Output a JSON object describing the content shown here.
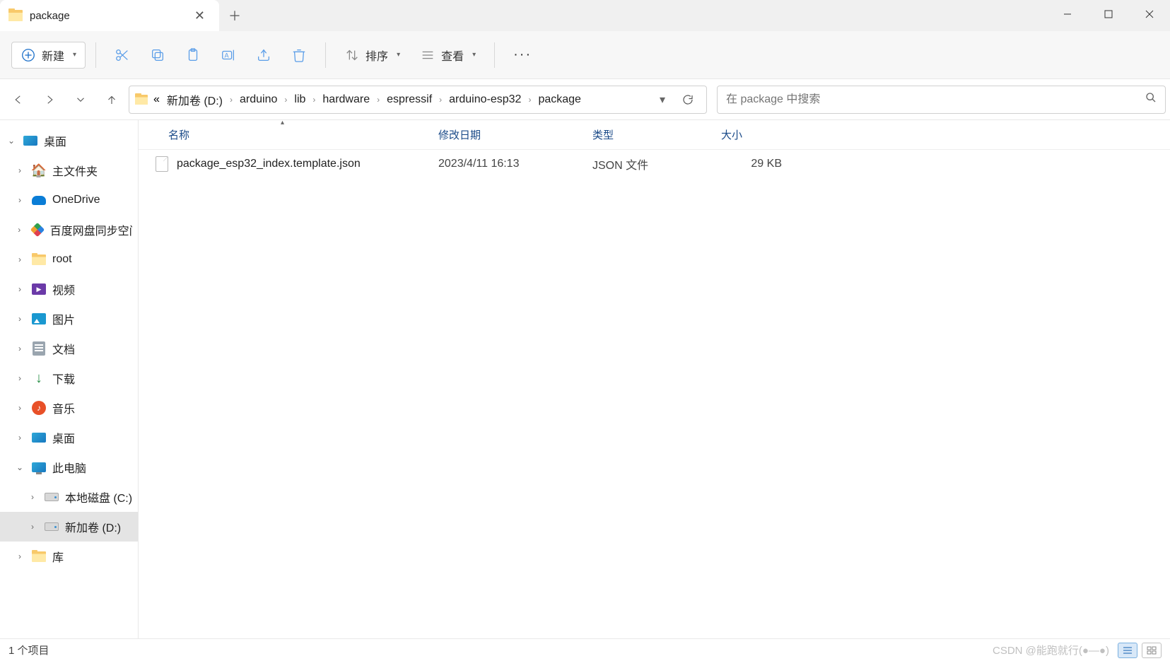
{
  "tab": {
    "title": "package"
  },
  "toolbar": {
    "new_label": "新建",
    "sort_label": "排序",
    "view_label": "查看"
  },
  "breadcrumb": {
    "overflow": "«",
    "items": [
      "新加卷 (D:)",
      "arduino",
      "lib",
      "hardware",
      "espressif",
      "arduino-esp32",
      "package"
    ]
  },
  "search": {
    "placeholder": "在 package 中搜索"
  },
  "sidebar": {
    "items": [
      {
        "label": "桌面",
        "icon": "desktop",
        "caret": "down",
        "indent": 0
      },
      {
        "label": "主文件夹",
        "icon": "home",
        "caret": "right",
        "indent": 1
      },
      {
        "label": "OneDrive",
        "icon": "onedrive",
        "caret": "right",
        "indent": 1
      },
      {
        "label": "百度网盘同步空间",
        "icon": "baidu",
        "caret": "right",
        "indent": 1
      },
      {
        "label": "root",
        "icon": "folder",
        "caret": "right",
        "indent": 1
      },
      {
        "label": "视频",
        "icon": "video",
        "caret": "right",
        "indent": 1
      },
      {
        "label": "图片",
        "icon": "pics",
        "caret": "right",
        "indent": 1
      },
      {
        "label": "文档",
        "icon": "docs",
        "caret": "right",
        "indent": 1
      },
      {
        "label": "下载",
        "icon": "dl",
        "caret": "right",
        "indent": 1
      },
      {
        "label": "音乐",
        "icon": "music",
        "caret": "right",
        "indent": 1
      },
      {
        "label": "桌面",
        "icon": "desktop",
        "caret": "right",
        "indent": 1
      },
      {
        "label": "此电脑",
        "icon": "pc",
        "caret": "down",
        "indent": 1
      },
      {
        "label": "本地磁盘 (C:)",
        "icon": "drive",
        "caret": "right",
        "indent": 2
      },
      {
        "label": "新加卷 (D:)",
        "icon": "drive",
        "caret": "right",
        "indent": 2,
        "selected": true
      },
      {
        "label": "库",
        "icon": "folder",
        "caret": "right",
        "indent": 1
      }
    ]
  },
  "columns": {
    "name": "名称",
    "date": "修改日期",
    "type": "类型",
    "size": "大小"
  },
  "files": [
    {
      "name": "package_esp32_index.template.json",
      "date": "2023/4/11 16:13",
      "type": "JSON 文件",
      "size": "29 KB"
    }
  ],
  "status": {
    "count": "1 个项目"
  },
  "watermark": "CSDN @能跑就行(●—●)"
}
